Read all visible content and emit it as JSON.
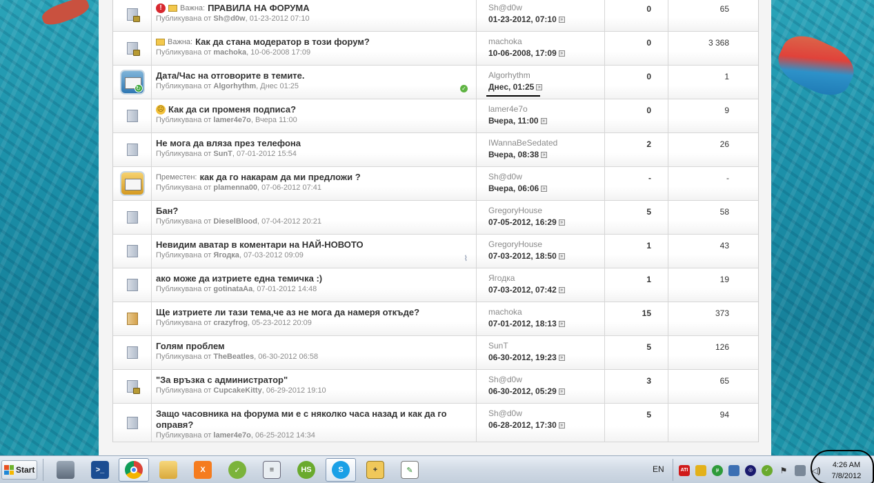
{
  "topics": [
    {
      "icon": "locked",
      "prefix": "Важна:",
      "badge": "important",
      "title": "ПРАВИЛА НА ФОРУМА",
      "posted_by_label": "Публикувана от",
      "author": "Sh@d0w",
      "date": "01-23-2012 07:10",
      "last_user": "Sh@d0w",
      "last_date": "01-23-2012, 07:10",
      "replies": "0",
      "views": "65"
    },
    {
      "icon": "locked",
      "prefix": "Важна:",
      "badge": "note",
      "title": "Как да стана модератор в този форум?",
      "posted_by_label": "Публикувана от",
      "author": "machoka",
      "date": "10-06-2008 17:09",
      "last_user": "machoka",
      "last_date": "10-06-2008, 17:09",
      "replies": "0",
      "views": "3 368"
    },
    {
      "icon": "envelope",
      "prefix": "",
      "badge": "",
      "title": "Дата/Час на отговорите в темите.",
      "posted_by_label": "Публикувана от",
      "author": "Algorhythm",
      "date": "Днес 01:25",
      "last_user": "Algorhythm",
      "last_date": "Днес, 01:25",
      "replies": "0",
      "views": "1"
    },
    {
      "icon": "doc",
      "prefix": "",
      "badge": "smiley",
      "title": "Как да си променя подписа?",
      "posted_by_label": "Публикувана от",
      "author": "lamer4e7o",
      "date": "Вчера 11:00",
      "last_user": "lamer4e7o",
      "last_date": "Вчера, 11:00",
      "replies": "0",
      "views": "9"
    },
    {
      "icon": "doc",
      "prefix": "",
      "badge": "",
      "title": "Не мога да вляза през телефона",
      "posted_by_label": "Публикувана от",
      "author": "SunT",
      "date": "07-01-2012 15:54",
      "last_user": "IWannaBeSedated",
      "last_date": "Вчера, 08:38",
      "replies": "2",
      "views": "26"
    },
    {
      "icon": "envelope-moved",
      "prefix": "Преместен:",
      "badge": "",
      "title": "как да го накарам да ми предложи ?",
      "posted_by_label": "Публикувана от",
      "author": "plamenna00",
      "date": "07-06-2012 07:41",
      "last_user": "Sh@d0w",
      "last_date": "Вчера, 06:06",
      "replies": "-",
      "views": "-"
    },
    {
      "icon": "doc",
      "prefix": "",
      "badge": "",
      "title": "Бан?",
      "posted_by_label": "Публикувана от",
      "author": "DieselBlood",
      "date": "07-04-2012 20:21",
      "last_user": "GregoryHouse",
      "last_date": "07-05-2012, 16:29",
      "replies": "5",
      "views": "58"
    },
    {
      "icon": "doc",
      "prefix": "",
      "badge": "",
      "title": "Невидим аватар в коментари на НАЙ-НОВОТО",
      "posted_by_label": "Публикувана от",
      "author": "Ягодка",
      "date": "07-03-2012 09:09",
      "last_user": "GregoryHouse",
      "last_date": "07-03-2012, 18:50",
      "replies": "1",
      "views": "43"
    },
    {
      "icon": "doc",
      "prefix": "",
      "badge": "",
      "title": "ако може да изтриете една темичка :)",
      "posted_by_label": "Публикувана от",
      "author": "gotinataAa",
      "date": "07-01-2012 14:48",
      "last_user": "Ягодка",
      "last_date": "07-03-2012, 07:42",
      "replies": "1",
      "views": "19"
    },
    {
      "icon": "folder",
      "prefix": "",
      "badge": "",
      "title": "Ще изтриете ли тази тема,че аз не мога да намеря откъде?",
      "posted_by_label": "Публикувана от",
      "author": "crazyfrog",
      "date": "05-23-2012 20:09",
      "last_user": "machoka",
      "last_date": "07-01-2012, 18:13",
      "replies": "15",
      "views": "373"
    },
    {
      "icon": "doc",
      "prefix": "",
      "badge": "",
      "title": "Голям проблем",
      "posted_by_label": "Публикувана от",
      "author": "TheBeatles",
      "date": "06-30-2012 06:58",
      "last_user": "SunT",
      "last_date": "06-30-2012, 19:23",
      "replies": "5",
      "views": "126"
    },
    {
      "icon": "locked",
      "prefix": "",
      "badge": "",
      "title": "\"За връзка с администратор\"",
      "posted_by_label": "Публикувана от",
      "author": "CupcakeKitty",
      "date": "06-29-2012 19:10",
      "last_user": "Sh@d0w",
      "last_date": "06-30-2012, 05:29",
      "replies": "3",
      "views": "65"
    },
    {
      "icon": "doc",
      "prefix": "",
      "badge": "",
      "title": "Защо часовника на форума ми е с няколко часа назад и как да го оправя?",
      "posted_by_label": "Публикувана от",
      "author": "lamer4e7o",
      "date": "06-25-2012 14:34",
      "last_user": "Sh@d0w",
      "last_date": "06-28-2012, 17:30",
      "replies": "5",
      "views": "94"
    }
  ],
  "taskbar": {
    "start_label": "Start",
    "language": "EN",
    "time": "4:26 AM",
    "date": "7/8/2012",
    "apps": [
      "server-manager",
      "powershell",
      "chrome",
      "explorer",
      "xampp",
      "tool",
      "console",
      "hs",
      "skype",
      "screenshot",
      "notepad-plus"
    ]
  },
  "colors": {
    "accent": "#3a77b5",
    "text": "#333333",
    "muted": "#8a8a8a"
  }
}
